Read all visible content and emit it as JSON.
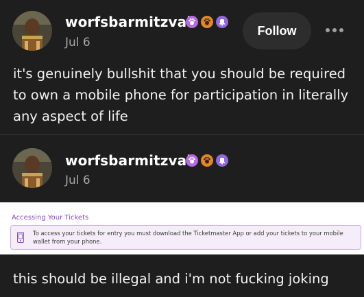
{
  "post1": {
    "username": "worfsbarmitzvah",
    "date": "Jul 6",
    "follow_label": "Follow",
    "text": "it's genuinely bullshit that you should be required to own a mobile phone for participation in literally any aspect of life"
  },
  "post2": {
    "username": "worfsbarmitzvah",
    "date": "Jul 6"
  },
  "ticket_notice": {
    "title": "Accessing Your Tickets",
    "message": "To access your tickets for entry you must download the Ticketmaster App or add your tickets to your mobile wallet from your phone."
  },
  "reblog_text": "this should be illegal and i'm not fucking joking",
  "badges": [
    {
      "icon": "paw-badge-icon",
      "color": "#b56be0"
    },
    {
      "icon": "paw-badge-icon",
      "color": "#e0862f"
    },
    {
      "icon": "bell-badge-icon",
      "color": "#8f6ad8"
    }
  ],
  "colors": {
    "background": "#1e1e1e",
    "follow_bg": "#2d2d2d",
    "accent_purple": "#8a4bbf"
  }
}
